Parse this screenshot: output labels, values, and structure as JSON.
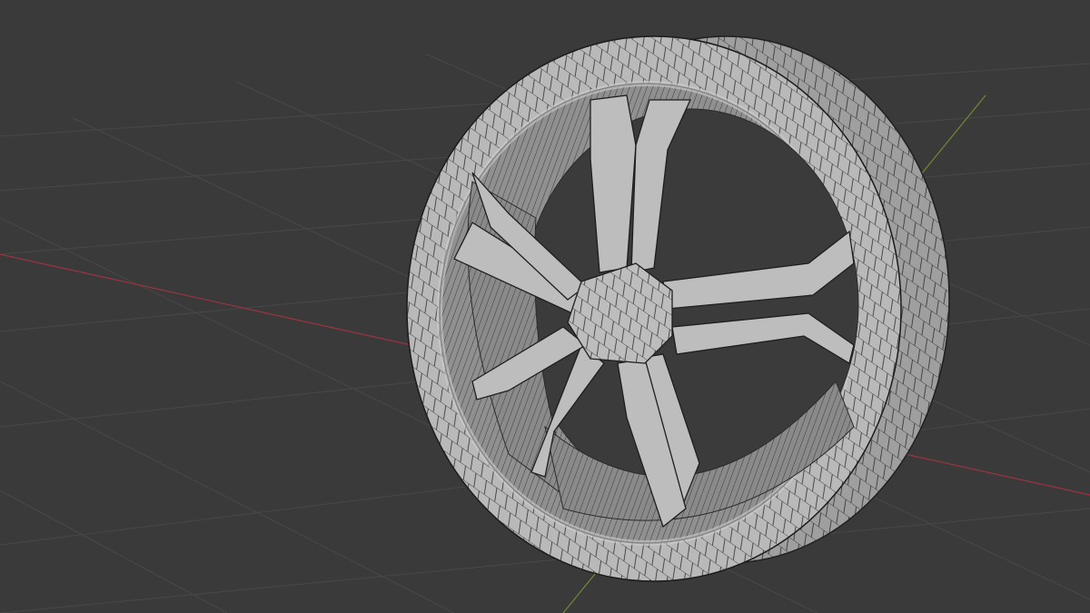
{
  "viewport": {
    "background": "#3a3a3a",
    "grid_color": "#4a4a4a",
    "x_axis_color": "#b23a48",
    "y_axis_color": "#7e9a3a"
  },
  "model": {
    "object": "wheel-rim",
    "shading": "solid-wireframe",
    "surface_color": "#b9b9b9",
    "inner_color": "#8e8e8e",
    "wire_color": "#1f1f1f",
    "spoke_count": 5,
    "spoke_style": "split-y"
  }
}
